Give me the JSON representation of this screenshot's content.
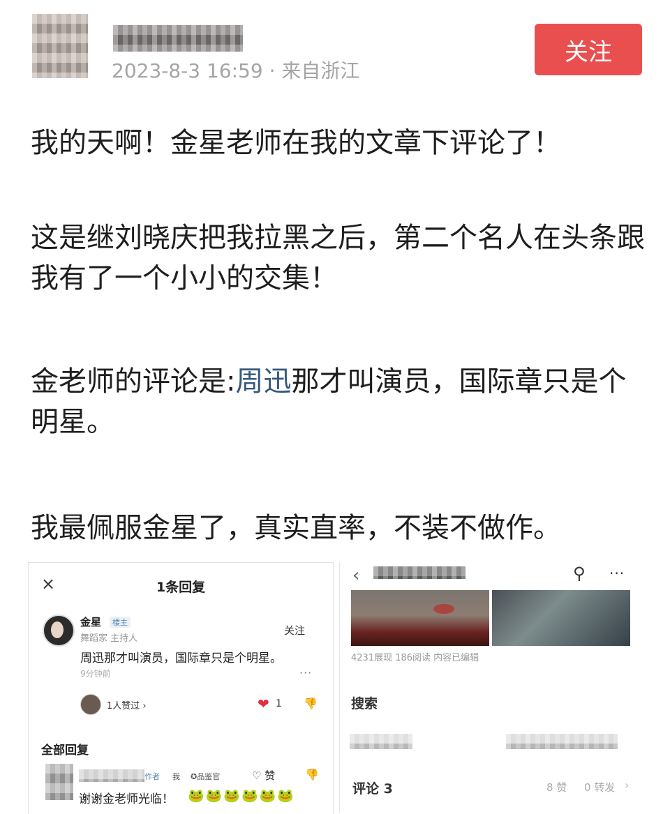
{
  "post": {
    "timestamp": "2023-8-3 16:59",
    "separator": "·",
    "location": "来自浙江",
    "follow_label": "关注",
    "paragraphs": {
      "p1": "我的天啊！金星老师在我的文章下评论了！",
      "p2": "这是继刘晓庆把我拉黑之后，第二个名人在头条跟我有了一个小小的交集！",
      "p3_before": "金老师的评论是:",
      "p3_link": "周迅",
      "p3_after": "那才叫演员，国际章只是个明星。",
      "p4": "我最佩服金星了，真实直率，不装不做作。"
    }
  },
  "left_panel": {
    "close_icon": "×",
    "title": "1条回复",
    "commenter_name": "金星",
    "commenter_badge": "楼主",
    "commenter_role": "舞蹈家 主持人",
    "follow_label": "关注",
    "comment_text": "周迅那才叫演员，国际章只是个明星。",
    "time": "9分钟前",
    "more_icon": "···",
    "likers_text": "1人赞过 ›",
    "heart_icon": "❤",
    "like_count": "1",
    "dislike_icon": "👎",
    "all_replies_title": "全部回复",
    "reply_author_tag": "作者",
    "reply_me": "我",
    "reply_reviewer": "✪品鉴官",
    "reply_like": "♡ 赞",
    "reply_text": "谢谢金老师光临！",
    "reply_emojis": "🐸🐸🐸🐸🐸🐸"
  },
  "right_panel": {
    "back_icon": "‹",
    "search_icon": "⚲",
    "more_icon": "···",
    "stats": "4231展现  186阅读  内容已编辑",
    "search_label": "搜索",
    "comments_label": "评论 3",
    "likes": "8 赞",
    "shares": "0 转发",
    "arrow_icon": "›"
  },
  "colors": {
    "follow_button": "#e94f4f",
    "link": "#35587f"
  }
}
